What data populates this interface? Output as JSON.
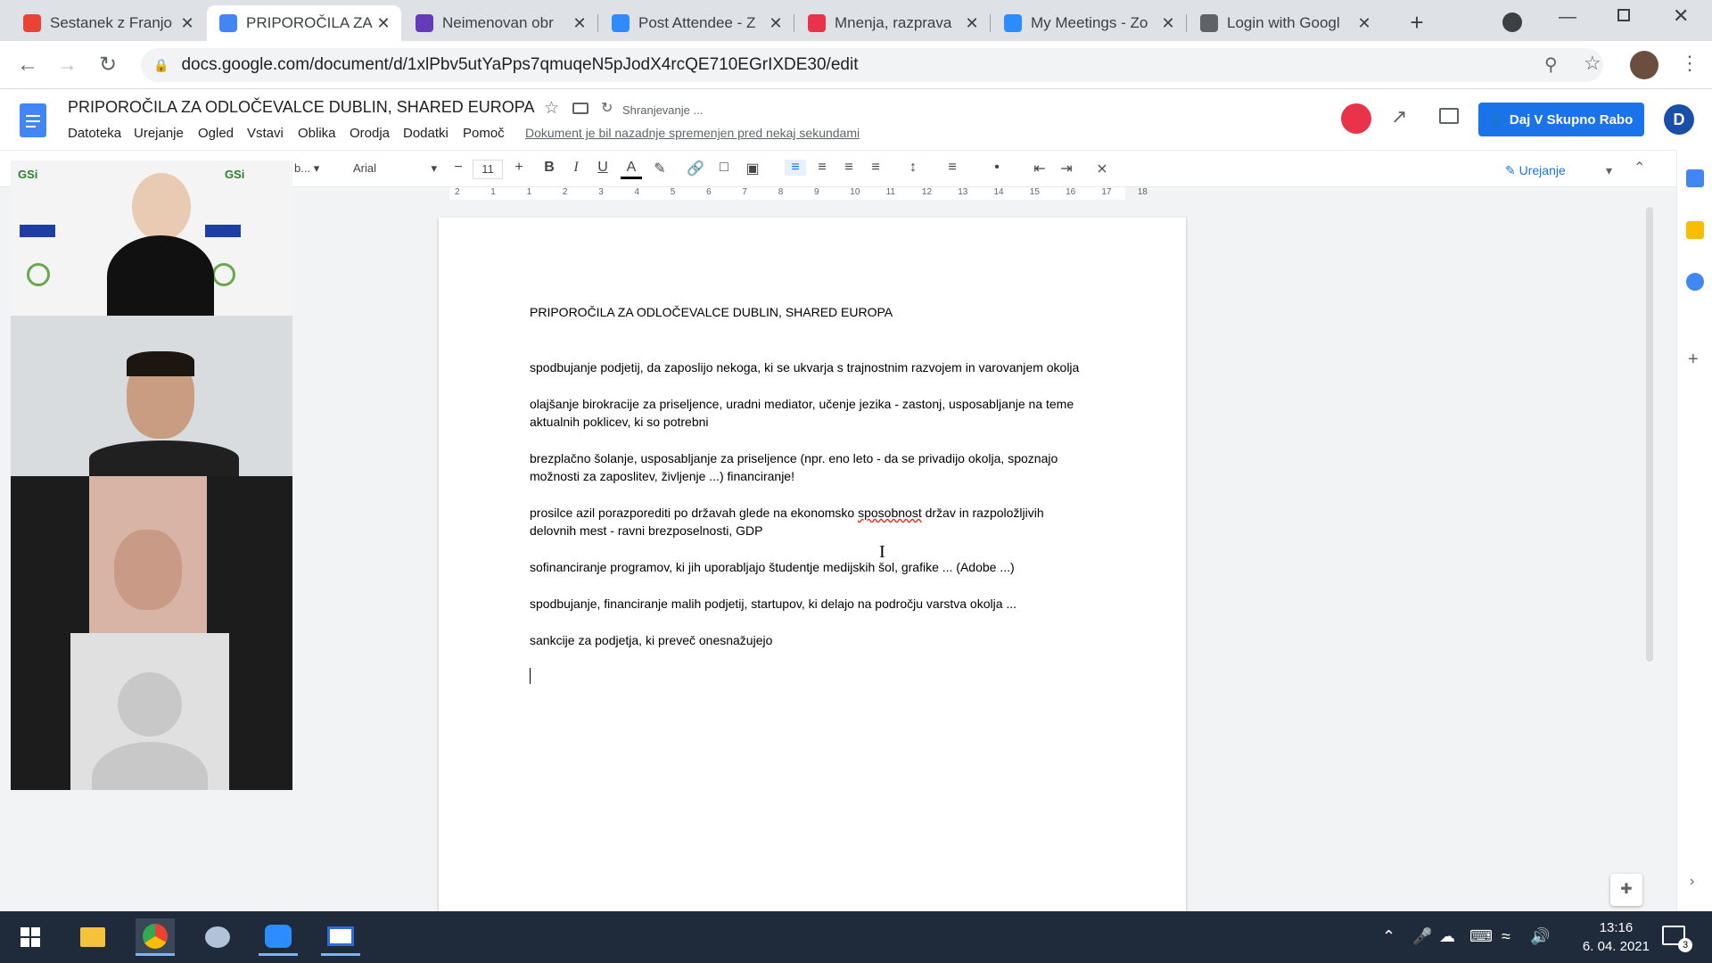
{
  "browser": {
    "tabs": [
      {
        "title": "Sestanek z Franjo",
        "icon": "gmail-icon",
        "color": "#ea4335"
      },
      {
        "title": "PRIPOROČILA ZA",
        "icon": "docs-icon",
        "color": "#4285f4"
      },
      {
        "title": "Neimenovan obr",
        "icon": "forms-icon",
        "color": "#673ab7"
      },
      {
        "title": "Post Attendee - Z",
        "icon": "zoom-icon",
        "color": "#2d8cff"
      },
      {
        "title": "Mnenja, razprava",
        "icon": "mentimeter-icon",
        "color": "#e8334a"
      },
      {
        "title": "My Meetings - Zo",
        "icon": "zoom-icon",
        "color": "#2d8cff"
      },
      {
        "title": "Login with Googl",
        "icon": "globe-icon",
        "color": "#5f6368"
      }
    ],
    "active_tab": 1,
    "url": "docs.google.com/document/d/1xlPbv5utYaPps7qmuqeN5pJodX4rcQE710EGrIXDE30/edit"
  },
  "docs": {
    "title": "PRIPOROČILA ZA ODLOČEVALCE DUBLIN, SHARED EUROPA",
    "saving_status": "Shranjevanje ...",
    "menus": [
      "Datoteka",
      "Urejanje",
      "Ogled",
      "Vstavi",
      "Oblika",
      "Orodja",
      "Dodatki",
      "Pomoč"
    ],
    "last_edit": "Dokument je bil nazadnje spremenjen pred nekaj sekundami",
    "share_label": "Daj V Skupno Rabo",
    "avatar_letter": "D",
    "style_select": "b...",
    "font": "Arial",
    "font_size": "11",
    "mode": "Urejanje",
    "ruler_ticks": [
      "2",
      "1",
      "1",
      "2",
      "3",
      "4",
      "5",
      "6",
      "7",
      "8",
      "9",
      "10",
      "11",
      "12",
      "13",
      "14",
      "15",
      "16",
      "17",
      "18"
    ]
  },
  "document": {
    "heading": "PRIPOROČILA ZA ODLOČEVALCE DUBLIN, SHARED EUROPA",
    "paragraphs": [
      "spodbujanje podjetij, da zaposlijo nekoga, ki se ukvarja s trajnostnim razvojem in varovanjem okolja",
      "olajšanje birokracije za priseljence, uradni mediator, učenje jezika - zastonj, usposabljanje na teme aktualnih poklicev, ki so potrebni",
      "brezplačno šolanje, usposabljanje za priseljence (npr. eno leto - da se privadijo okolja, spoznajo možnosti za zaposlitev, življenje ...) financiranje!",
      "prosilce azil porazporediti po državah glede na ekonomsko sposobnost držav in razpoložljivih delovnih mest - ravni brezposelnosti, GDP",
      "sofinanciranje programov, ki jih uporabljajo študentje medijskih šol, grafike ... (Adobe ...)",
      "spodbujanje, financiranje malih podjetij, startupov, ki delajo na področju varstva okolja ...",
      "sankcije za podjetja, ki preveč onesnažujejo"
    ]
  },
  "taskbar": {
    "time": "13:16",
    "date": "6. 04. 2021",
    "notifications": "3"
  }
}
